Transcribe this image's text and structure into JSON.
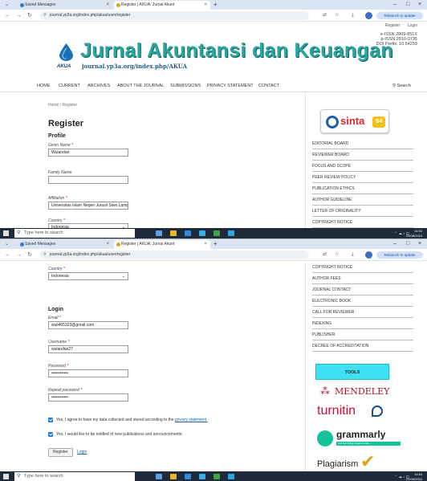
{
  "browser": {
    "tab_inactive": "Saved Messages",
    "tab_active": "Register | AKUA: Jurnal Akunt",
    "url": "journal.yp3a.org/index.php/akua/user/register",
    "relaunch_label": "Relaunch to update",
    "win_min": "–",
    "win_close": "×",
    "new_tab": "+"
  },
  "taskbar": {
    "search_placeholder": "Type here to search",
    "time": "11:54",
    "date": "21/08/2024"
  },
  "site": {
    "header_links": {
      "register": "Register",
      "login": "Login"
    },
    "issn": [
      "e-ISSN 2809-851X",
      "p-ISSN 2810-0735",
      "DOI Prefix: 10.54259"
    ],
    "logo_text": "AKUA",
    "title": "Jurnal Akuntansi dan Keuangan",
    "url_text": "journal.yp3a.org/index.php/AKUA",
    "nav": [
      "HOME",
      "CURRENT",
      "ARCHIVES",
      "ABOUT THE JOURNAL",
      "SUBMISSIONS",
      "PRIVACY STATEMENT",
      "CONTACT"
    ],
    "search_label": "Search"
  },
  "form": {
    "breadcrumb": "Home / Register",
    "heading": "Register",
    "profile_heading": "Profile",
    "given_name_label": "Given Name",
    "given_name_value": "Wulandari",
    "family_name_label": "Family Name",
    "family_name_value": "",
    "affiliation_label": "Affiliation",
    "affiliation_value": "Universitas Islam Negeri Jurusil Siwo Lamp",
    "country_label": "Country",
    "country_value": "Indonesia",
    "login_heading": "Login",
    "email_label": "Email",
    "email_value": "wuli465323@gmail.com",
    "username_label": "Username",
    "username_value": "wulandari27",
    "password_label": "Password",
    "password_value": "••••••••••••",
    "repeat_password_label": "Repeat password",
    "repeat_password_value": "••••••••••••",
    "consent_text": "Yes, I agree to have my data collected and stored according to the ",
    "consent_link": "privacy statement.",
    "notify_text": "Yes, I would like to be notified of new publications and announcements.",
    "register_button": "Register",
    "login_link": "Login",
    "required_mark": "*"
  },
  "sidebar": {
    "sinta_label": "sinta",
    "sinta_rank": "S4",
    "menu_top": [
      "EDITORIAL BOARD",
      "REVIEWER BOARD",
      "FOCUS AND SCOPE",
      "PEER REVIEW POLICY",
      "PUBLICATION ETHICS",
      "AUTHOR GUIDELINE",
      "LETTER OF ORIGINALITY",
      "COPYRIGHT NOTICE"
    ],
    "menu_bottom": [
      "COPYRIGHT NOTICE",
      "AUTHOR FEES",
      "JOURNAL CONTACT",
      "ELECTRONIC BOOK",
      "CALL FOR REVIEWER",
      "INDEXING",
      "PUBLISHER",
      "DECREE OF ACCREDITATION"
    ],
    "tools_label": "TOOLS",
    "mendeley": "MENDELEY",
    "turnitin": "turnitin",
    "grammarly": "grammarly",
    "grammarly_tagline": "Your best writing, anywhere online",
    "plagiarism": "Plagiarism"
  },
  "colors": {
    "title_teal": "#2aa5a0",
    "link_blue": "#1a5ea8",
    "taskbar": "#1f2a3a",
    "tools_cyan": "#3fe0f0"
  }
}
